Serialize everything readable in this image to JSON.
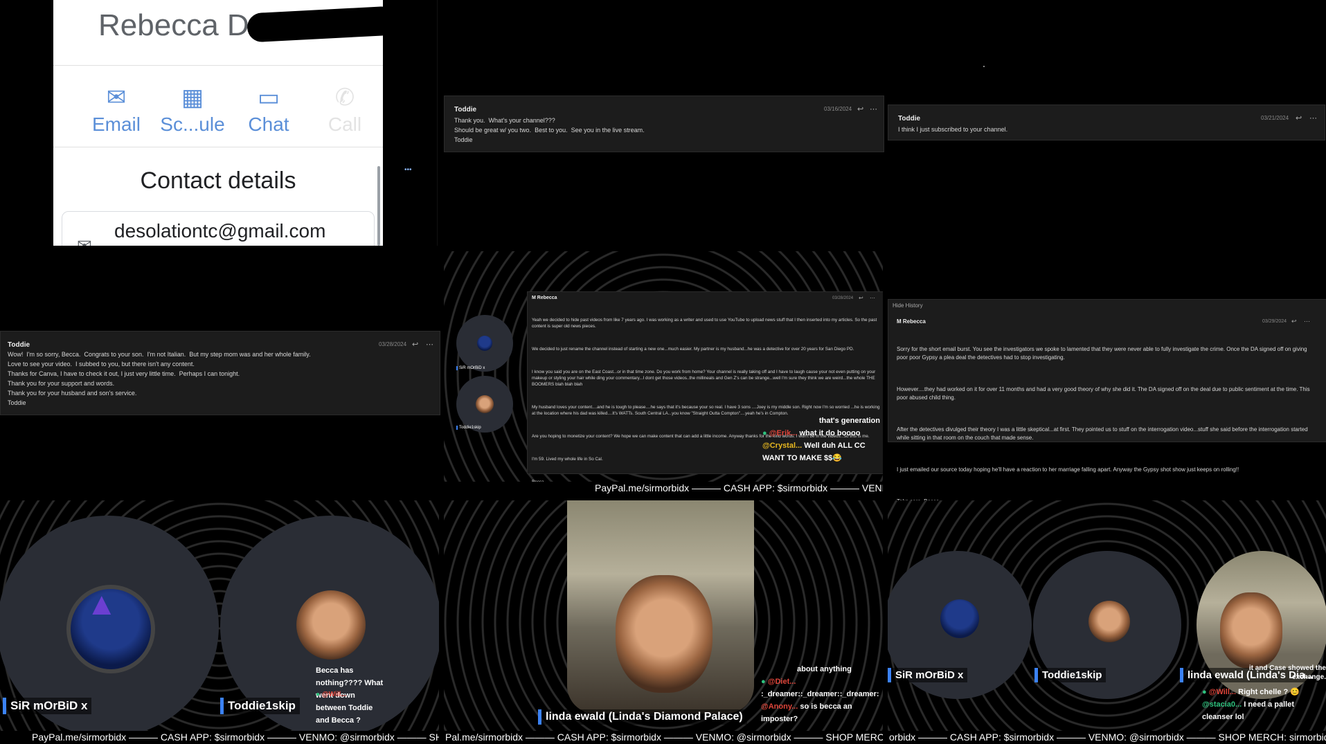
{
  "contact": {
    "name": "Rebecca D",
    "actions": [
      {
        "icon": "email-icon",
        "label": "Email"
      },
      {
        "icon": "calendar-icon",
        "label": "Sc...ule"
      },
      {
        "icon": "chat-icon",
        "label": "Chat"
      },
      {
        "icon": "call-icon",
        "label": "Call"
      }
    ],
    "details_heading": "Contact details",
    "email": "desolationtc@gmail.com"
  },
  "menu_dots": "•••",
  "emails": {
    "e1": {
      "from": "Toddie",
      "date": "03/16/2024",
      "body": "Thank you.  What's your channel???\nShould be great w/ you two.  Best to you.  See you in the live stream.\nToddie"
    },
    "e2": {
      "from": "Toddie",
      "date": "03/21/2024",
      "body": "I think I just subscribed to your channel."
    },
    "e3": {
      "from": "Toddie",
      "date": "03/28/2024",
      "body": "Wow!  I'm so sorry, Becca.  Congrats to your son.  I'm not Italian.  But my step mom was and her whole family.\nLove to see your video.  I subbed to you, but there isn't any content.\nThanks for Canva, I have to check it out, I just very little time.  Perhaps I can tonight.\nThank you for your support and words.\nThank you for your husband and son's service.\nToddie"
    },
    "e4": {
      "hide_history": "Hide History",
      "from": "M Rebecca",
      "date": "03/29/2024",
      "paragraphs": [
        "Sorry for the short email burst. You see the investigators we spoke to lamented that they were never able to fully investigate the crime. Once the DA signed off on giving poor poor Gypsy a plea deal the detectives had to stop investigating.",
        "However....they had worked on it for over 11 months and had a very good theory of why she did it. The DA signed off on the deal due to public sentiment at the time. This poor abused child thing.",
        "After the detectives divulged their theory I was a little skeptical...at first. They pointed us to stuff on the interrogation video...stuff she said before the interrogation started while sitting in that room on the couch that made sense.",
        "I just emailed our source today hoping he'll have a reaction to her marriage falling apart. Anyway the Gypsy shot show just keeps on rolling!!",
        "Take care. Becca."
      ]
    },
    "e5": {
      "from": "M Rebecca",
      "date": "03/28/2024",
      "paragraphs": [
        "Yeah we decided to hide past videos from like 7 years ago. I was working as a writer and used to use YouTube to upload news stuff that I then inserted into my articles. So the past content is super old news pieces.",
        "We decided to just rename the channel instead of starting a new one...much easier. My partner is my husband...he was a detective for over 20 years for San Diego PD.",
        "I know you said you are on the East Coast...or in that time zone. Do you work from home? Your channel is really taking off and I have to laugh cause your not even putting on your makeup or styling your hair while ding your commentary...I dont get those videos..the millineals and Gen Z's can be strange...well I'm sure they think we are weird...the whole THE BOOMERS blah blah blah",
        "My husband loves your content....and he is tough to please....he says that it's because your so real. I have 3 sons ....Joey is my middle son. Right now I'm so worried ...he is working at the location where his dad was killed....It's WATTs. South Central LA...you know \"Straight Outta Compton\"....yeah he's in Compton.",
        "Are you hoping to monetize your content? We hope we can make content that can add a little income. Anyway thanks for the kind words. I won't be in the videos...so this is me.",
        "I'm 59. Lived my whole life in So Cal.",
        "Becca"
      ]
    }
  },
  "mid_overlay": {
    "avatars": [
      "SiR mOrBiD x",
      "Toddie1skip"
    ],
    "chat": [
      {
        "user": "",
        "text": "that's generation"
      },
      {
        "user": "@Erik...",
        "text": "what it do boooo"
      },
      {
        "user": "@Crystal...",
        "text": "Well duh ALL CC WANT TO MAKE $$😂"
      }
    ],
    "ticker": "PayPal.me/sirmorbidx ——— CASH APP: $sirmorbidx ——— VENM"
  },
  "bottom_left": {
    "participants": [
      "SiR mOrBiD x",
      "Toddie1skip"
    ],
    "chat_user": "@Will...",
    "chat_text": "Becca has nothing???? What went down between Toddie and Becca ?",
    "ticker": "PayPal.me/sirmorbidx ——— CASH APP: $sirmorbidx ——— VENMO: @sirmorbidx ——— SHOP"
  },
  "bottom_mid": {
    "participant": "linda ewald (Linda's Diamond Palace)",
    "chat": [
      {
        "user": "",
        "text": "about anything"
      },
      {
        "user": "@Diet...",
        "text": ":_dreamer::_dreamer::_dreamer:"
      },
      {
        "user": "@Anony...",
        "text": "so is becca an imposter?"
      }
    ],
    "ticker": "Pal.me/sirmorbidx ——— CASH APP: $sirmorbidx ——— VENMO: @sirmorbidx ——— SHOP MERCH: si"
  },
  "bottom_right": {
    "participants": [
      "SiR mOrBiD x",
      "Toddie1skip",
      "linda ewald (Linda's Dia..."
    ],
    "chat": [
      {
        "user": "",
        "text": "it and Case showed the exchange."
      },
      {
        "user": "@Will...",
        "text": "Right chelle ? 😊"
      },
      {
        "user": "@stacia0...",
        "text": "I need a pallet cleanser lol"
      }
    ],
    "ticker": "orbidx ——— CASH APP: $sirmorbidx ——— VENMO: @sirmorbidx ——— SHOP MERCH: sirmorbidx.com"
  }
}
